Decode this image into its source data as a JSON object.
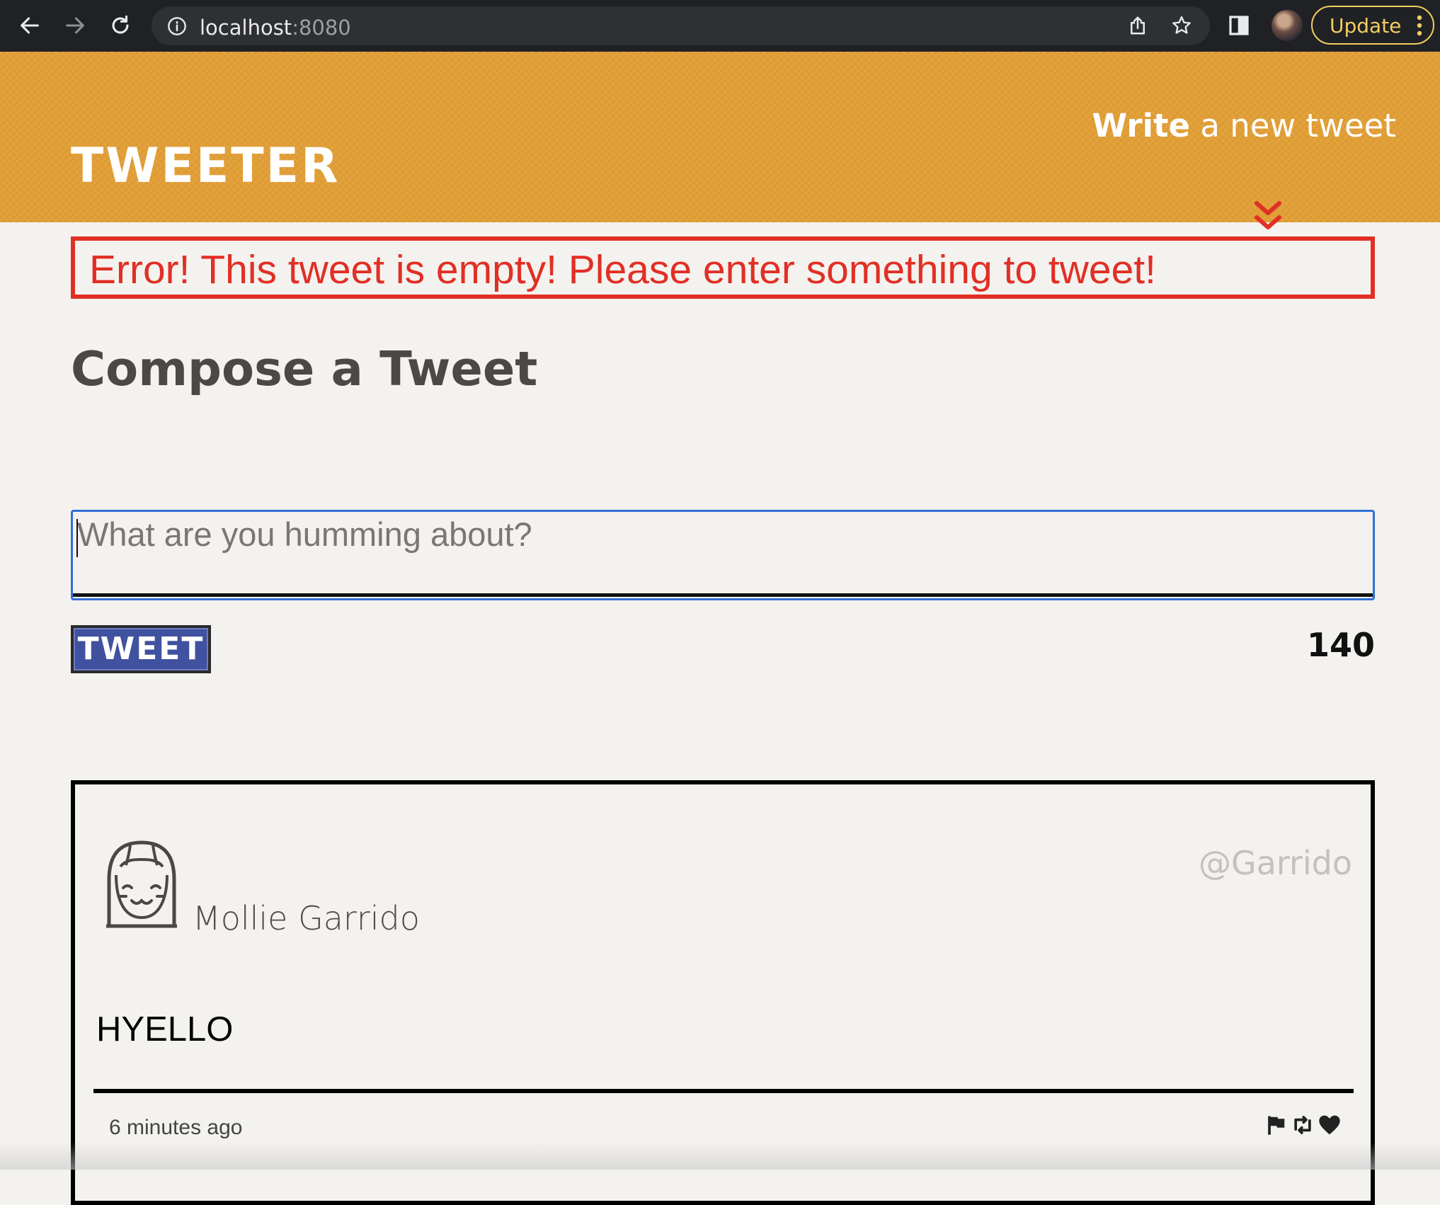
{
  "browser": {
    "url_host": "localhost",
    "url_port": ":8080",
    "update_label": "Update"
  },
  "header": {
    "logo": "TWEETER",
    "write_bold": "Write",
    "write_rest": " a new tweet"
  },
  "compose": {
    "error_message": "Error! This tweet is empty! Please enter something to tweet!",
    "title": "Compose a Tweet",
    "placeholder": "What are you humming about?",
    "submit_label": "TWEET",
    "counter": "140"
  },
  "tweets": [
    {
      "display_name": "Mollie Garrido",
      "handle": "@Garrido",
      "content": "HYELLO",
      "timestamp": "6 minutes ago"
    }
  ],
  "colors": {
    "header_bg": "#e29f36",
    "error": "#e12f25",
    "tweet_button": "#4051a0",
    "input_focus": "#3170d6"
  },
  "icons": [
    "back-icon",
    "forward-icon",
    "reload-icon",
    "info-icon",
    "share-icon",
    "bookmark-star-icon",
    "side-panel-icon",
    "chevron-double-down-icon",
    "avatar-icon",
    "flag-icon",
    "retweet-icon",
    "heart-icon",
    "menu-dots-icon"
  ]
}
